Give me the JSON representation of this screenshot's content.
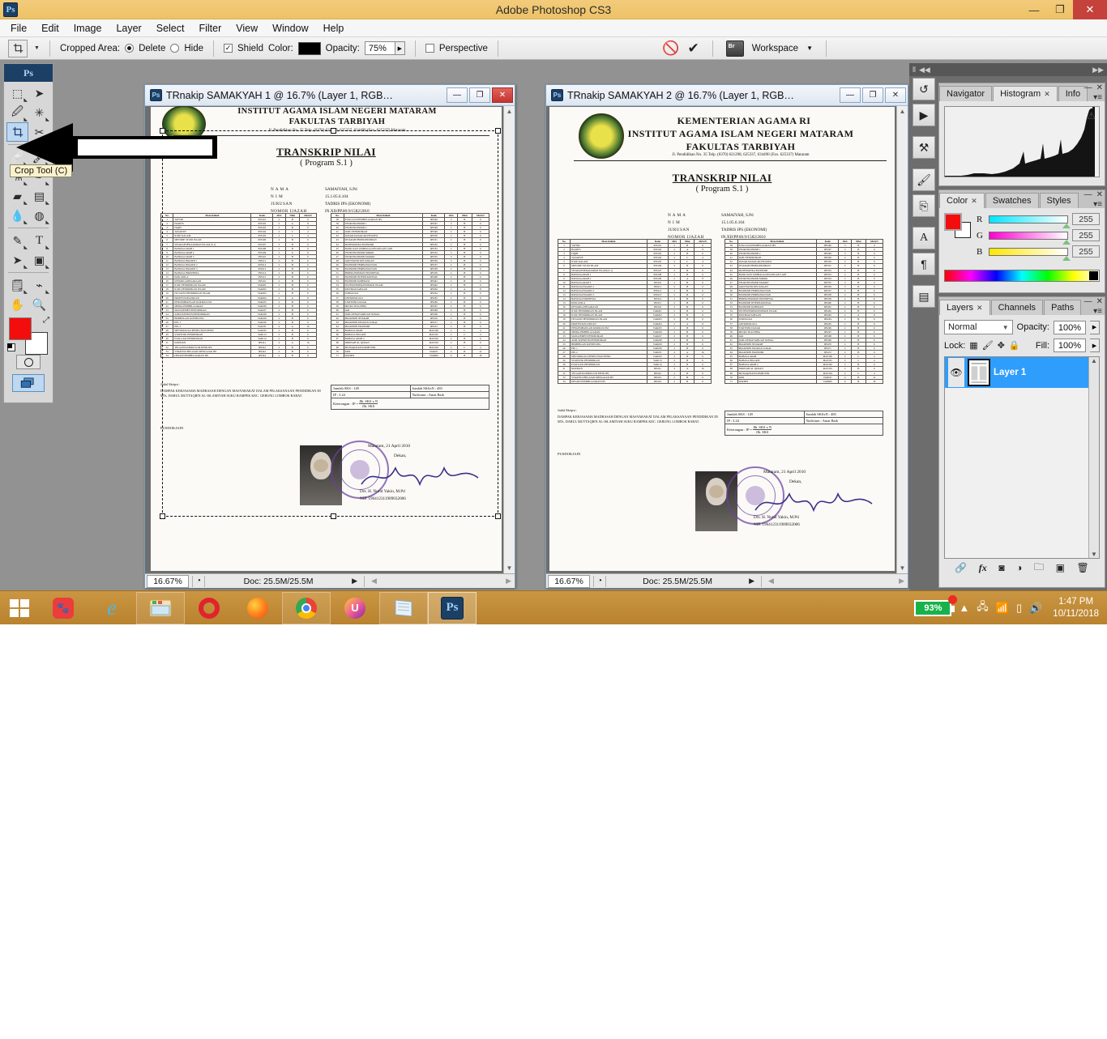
{
  "window": {
    "app_title": "Adobe Photoshop CS3",
    "app_badge": "Ps",
    "minimize": "—",
    "restore": "❐",
    "close": "✕"
  },
  "menubar": {
    "items": [
      "File",
      "Edit",
      "Image",
      "Layer",
      "Select",
      "Filter",
      "View",
      "Window",
      "Help"
    ]
  },
  "options_bar": {
    "tool_icon": "crop-tool-icon",
    "cropped_area_label": "Cropped Area:",
    "delete_label": "Delete",
    "hide_label": "Hide",
    "shield_label": "Shield",
    "color_label": "Color:",
    "color_value": "#000000",
    "opacity_label": "Opacity:",
    "opacity_value": "75%",
    "perspective_label": "Perspective",
    "cancel_icon": "cancel-crop-icon",
    "commit_icon": "commit-crop-icon",
    "bridge_icon": "go-to-bridge-icon",
    "workspace_label": "Workspace"
  },
  "toolbox": {
    "logo": "Ps",
    "tooltip": "Crop Tool (C)",
    "tools": [
      {
        "name": "marquee-tool",
        "glyph": "⬚"
      },
      {
        "name": "move-tool",
        "glyph": "➤"
      },
      {
        "name": "lasso-tool",
        "glyph": "✎"
      },
      {
        "name": "magic-wand-tool",
        "glyph": "✳"
      },
      {
        "name": "crop-tool",
        "glyph": "⌗",
        "selected": true
      },
      {
        "name": "slice-tool",
        "glyph": "✂"
      },
      {
        "name": "healing-brush-tool",
        "glyph": "✒"
      },
      {
        "name": "brush-tool",
        "glyph": "🖌"
      },
      {
        "name": "clone-stamp-tool",
        "glyph": "⚲"
      },
      {
        "name": "history-brush-tool",
        "glyph": "✏"
      },
      {
        "name": "eraser-tool",
        "glyph": "◻"
      },
      {
        "name": "gradient-tool",
        "glyph": "▤"
      },
      {
        "name": "blur-tool",
        "glyph": "💧"
      },
      {
        "name": "dodge-tool",
        "glyph": "◐"
      },
      {
        "name": "pen-tool",
        "glyph": "✑"
      },
      {
        "name": "type-tool",
        "glyph": "T"
      },
      {
        "name": "path-selection-tool",
        "glyph": "➚"
      },
      {
        "name": "rectangle-tool",
        "glyph": "▣"
      },
      {
        "name": "notes-tool",
        "glyph": "▤"
      },
      {
        "name": "eyedropper-tool",
        "glyph": "⌁"
      },
      {
        "name": "hand-tool",
        "glyph": "✋"
      },
      {
        "name": "zoom-tool",
        "glyph": "🔍"
      }
    ],
    "foreground_color": "#f40d0d",
    "background_color": "#ffffff",
    "quick_mask": "quick-mask-icon",
    "screen_mode": "screen-mode-icon"
  },
  "documents": [
    {
      "title": "TRnakip SAMAKYAH 1 @ 16.7% (Layer 1, RGB…",
      "zoom": "16.67%",
      "doc_size": "Doc: 25.5M/25.5M",
      "has_crop_marquee": true,
      "close_style": "red"
    },
    {
      "title": "TRnakip SAMAKYAH 2 @ 16.7% (Layer 1, RGB…",
      "zoom": "16.67%",
      "doc_size": "Doc: 25.5M/25.5M",
      "has_crop_marquee": false,
      "close_style": "grey"
    }
  ],
  "scanned_document": {
    "ministry": "KEMENTERIAN AGAMA RI",
    "institute": "INSTITUT AGAMA ISLAM NEGERI MATARAM",
    "faculty": "FAKULTAS TARBIYAH",
    "address": "Jl. Pendidikan No. 35 Telp. (0370) 621298, 625337, 634490 (Fax. 625337) Mataram",
    "doc_title": "TRANSKRIP NILAI",
    "doc_subtitle": "( Program S.1 )",
    "fields": [
      {
        "label": "N A M A",
        "value": "SAMAIYAH, S.Pd"
      },
      {
        "label": "N I M",
        "value": "15.1.05.6.104"
      },
      {
        "label": "JURUSAN",
        "value": "TADRIS IPS (EKONOMI)"
      },
      {
        "label": "NOMOR IJAZAH",
        "value": "IN.XII/PP.00.9/1582/2010"
      }
    ],
    "table_headers": [
      "No.",
      "Mata Kuliah",
      "Kode",
      "SKS",
      "Nilai",
      "SKSxN"
    ],
    "courses_left": [
      {
        "no": "1",
        "name": "TAFSIR",
        "kode": "INS101",
        "sks": "2",
        "nilai": "B",
        "sksn": "6"
      },
      {
        "no": "2",
        "name": "HADITS",
        "kode": "INS102",
        "sks": "2",
        "nilai": "A",
        "sksn": "8"
      },
      {
        "no": "3",
        "name": "FIQIH",
        "kode": "INS103",
        "sks": "2",
        "nilai": "B",
        "sksn": "6"
      },
      {
        "no": "4",
        "name": "TASAWUF",
        "kode": "INS104",
        "sks": "2",
        "nilai": "C",
        "sksn": "4"
      },
      {
        "no": "5",
        "name": "ILMU KALAM",
        "kode": "INS105",
        "sks": "2",
        "nilai": "C",
        "sksn": "4"
      },
      {
        "no": "6",
        "name": "METODE STUDI ISLAM",
        "kode": "INS106",
        "sks": "2",
        "nilai": "B",
        "sksn": "6"
      },
      {
        "no": "7",
        "name": "SEJARAH PERADABAN ISLAM (S-1)",
        "kode": "INS107",
        "sks": "2",
        "nilai": "B",
        "sksn": "6"
      },
      {
        "no": "8",
        "name": "BAHASA ARAB 1",
        "kode": "INS108",
        "sks": "2",
        "nilai": "B",
        "sksn": "6"
      },
      {
        "no": "9",
        "name": "BAHASA ARAB 2",
        "kode": "INS109",
        "sks": "2",
        "nilai": "A",
        "sksn": "8"
      },
      {
        "no": "10",
        "name": "BAHASA ARAB 3",
        "kode": "INS110",
        "sks": "2",
        "nilai": "B",
        "sksn": "6"
      },
      {
        "no": "11",
        "name": "BAHASA INGGRIS 1",
        "kode": "INS211",
        "sks": "2",
        "nilai": "B",
        "sksn": "6"
      },
      {
        "no": "12",
        "name": "BAHASA INGGRIS 2",
        "kode": "INS212",
        "sks": "2",
        "nilai": "B",
        "sksn": "6"
      },
      {
        "no": "13",
        "name": "BAHASA INGGRIS 3",
        "kode": "INS213",
        "sks": "2",
        "nilai": "B",
        "sksn": "6"
      },
      {
        "no": "14",
        "name": "BAHASA INDONESIA",
        "kode": "INS114",
        "sks": "2",
        "nilai": "B",
        "sksn": "6"
      },
      {
        "no": "15",
        "name": "PANCASILA",
        "kode": "INS115",
        "sks": "2",
        "nilai": "B",
        "sksn": "6"
      },
      {
        "no": "16",
        "name": "KEWARGANEGARAAN",
        "kode": "INS116",
        "sks": "2",
        "nilai": "B",
        "sksn": "6"
      },
      {
        "no": "17",
        "name": "ILMU PENDIDIKAN ISLAM",
        "kode": "TAR201",
        "sks": "2",
        "nilai": "B",
        "sksn": "6"
      },
      {
        "no": "18",
        "name": "ILMU PENDIDIKAN ISLAM",
        "kode": "TAR202",
        "sks": "2",
        "nilai": "B",
        "sksn": "6"
      },
      {
        "no": "19",
        "name": "FILSAFAT PENDIDIKAN ISLAM",
        "kode": "TAR203",
        "sks": "2",
        "nilai": "B",
        "sksn": "6"
      },
      {
        "no": "20",
        "name": "PROFESI KEGURUAN",
        "kode": "TAR204",
        "sks": "2",
        "nilai": "A",
        "sksn": "8"
      },
      {
        "no": "21",
        "name": "PENGEMBANGAN KURIKULUM",
        "kode": "TAR225",
        "sks": "2",
        "nilai": "B",
        "sksn": "6"
      },
      {
        "no": "22",
        "name": "MEDIA PEMBELAJARAN",
        "kode": "TAR226",
        "sks": "2",
        "nilai": "B",
        "sksn": "6"
      },
      {
        "no": "23",
        "name": "MANAJEMEN PENDIDIKAN",
        "kode": "TAR227",
        "sks": "2",
        "nilai": "B",
        "sksn": "6"
      },
      {
        "no": "24",
        "name": "ADM SUPERVISI PENDIDIKAN",
        "kode": "TAR228",
        "sks": "2",
        "nilai": "B",
        "sksn": "6"
      },
      {
        "no": "25",
        "name": "BIMBINGAN KONSELING",
        "kode": "TAR229",
        "sks": "2",
        "nilai": "B",
        "sksn": "6"
      },
      {
        "no": "26",
        "name": "PPL 1",
        "kode": "TAR230",
        "sks": "2",
        "nilai": "B",
        "sksn": "6"
      },
      {
        "no": "27",
        "name": "PPL 2",
        "kode": "TAR231",
        "sks": "4",
        "nilai": "A",
        "sksn": "16"
      },
      {
        "no": "28",
        "name": "METODOLOGI PENELITIAN PEND",
        "kode": "TAR232",
        "sks": "2",
        "nilai": "B",
        "sksn": "6"
      },
      {
        "no": "29",
        "name": "STATISTIK PENDIDIKAN",
        "kode": "TAR113",
        "sks": "2",
        "nilai": "B",
        "sksn": "6"
      },
      {
        "no": "30",
        "name": "EVALUASI PENDIDIKAN",
        "kode": "TAR114",
        "sks": "2",
        "nilai": "B",
        "sksn": "6"
      },
      {
        "no": "31",
        "name": "KKP/KKN",
        "kode": "IPS241",
        "sks": "4",
        "nilai": "A",
        "sksn": "16"
      },
      {
        "no": "32",
        "name": "TELAAH KURIKULUM PEND IPS",
        "kode": "IPS242",
        "sks": "2",
        "nilai": "B",
        "sksn": "6"
      },
      {
        "no": "33",
        "name": "STRATEGI BELAJAR MENGAJAR IPS",
        "kode": "IPS243",
        "sks": "2",
        "nilai": "B",
        "sksn": "6"
      },
      {
        "no": "34",
        "name": "DESAIN PEMBELAJARAN IPS",
        "kode": "IPS244",
        "sks": "2",
        "nilai": "B",
        "sksn": "6"
      }
    ],
    "courses_right": [
      {
        "no": "38",
        "name": "EVALUASI PEMBELAJARAN IPS",
        "kode": "IPS346",
        "sks": "3",
        "nilai": "B",
        "sksn": "9"
      },
      {
        "no": "39",
        "name": "TEORI EKONOMI 1",
        "kode": "IPS347",
        "sks": "3",
        "nilai": "B",
        "sksn": "9"
      },
      {
        "no": "40",
        "name": "TEORI EKONOMI 2",
        "kode": "IPS348",
        "sks": "3",
        "nilai": "B",
        "sksn": "9"
      },
      {
        "no": "41",
        "name": "ILMU PENDIDIKAN",
        "kode": "IPS349",
        "sks": "2",
        "nilai": "B",
        "sksn": "6"
      },
      {
        "no": "42",
        "name": "DASAR-DASAR AKUNTANSI",
        "kode": "IPS350",
        "sks": "3",
        "nilai": "B",
        "sksn": "9"
      },
      {
        "no": "43",
        "name": "SEJARAH PEREKONOMIAN",
        "kode": "IPS351",
        "sks": "2",
        "nilai": "B",
        "sksn": "6"
      },
      {
        "no": "44",
        "name": "MATEMATIKA EKONOMI",
        "kode": "IPS352",
        "sks": "2",
        "nilai": "B",
        "sksn": "6"
      },
      {
        "no": "45",
        "name": "BANK DAN LEMBAGA KEUANGAN LAIN",
        "kode": "IPS353",
        "sks": "2",
        "nilai": "B",
        "sksn": "6"
      },
      {
        "no": "46",
        "name": "TEORI EKONOMI MIKRO",
        "kode": "IPS354",
        "sks": "3",
        "nilai": "B",
        "sksn": "9"
      },
      {
        "no": "47",
        "name": "TEORI EKONOMI MAKRO",
        "kode": "IPS355",
        "sks": "3",
        "nilai": "B",
        "sksn": "9"
      },
      {
        "no": "48",
        "name": "AKUNTANSI KEUANGAN",
        "kode": "IPS356",
        "sks": "3",
        "nilai": "B",
        "sksn": "9"
      },
      {
        "no": "49",
        "name": "EKONOMI PEMBANGUNAN",
        "kode": "IPS357",
        "sks": "2",
        "nilai": "B",
        "sksn": "6"
      },
      {
        "no": "50",
        "name": "EKONOMI PEMBANGUNAN",
        "kode": "IPS358",
        "sks": "2",
        "nilai": "B",
        "sksn": "6"
      },
      {
        "no": "51",
        "name": "PEREKONOMIAN INDONESIA",
        "kode": "IPS359",
        "sks": "2",
        "nilai": "B",
        "sksn": "6"
      },
      {
        "no": "52",
        "name": "EKONOMI INTERNASIONAL",
        "kode": "IPS460",
        "sks": "2",
        "nilai": "B",
        "sksn": "6"
      },
      {
        "no": "53",
        "name": "EKONOMI KOPERASI",
        "kode": "IPS461",
        "sks": "2",
        "nilai": "B",
        "sksn": "6"
      },
      {
        "no": "54",
        "name": "SISTEM PEREKONOMIAN ISLAM",
        "kode": "IPS462",
        "sks": "2",
        "nilai": "B",
        "sksn": "6"
      },
      {
        "no": "55",
        "name": "KEWIRAUSAHAAN",
        "kode": "IPS463",
        "sks": "2",
        "nilai": "A",
        "sksn": "8"
      },
      {
        "no": "56",
        "name": "SOSIOLOGI",
        "kode": "IPS264",
        "sks": "2",
        "nilai": "B",
        "sksn": "6"
      },
      {
        "no": "57",
        "name": "ANTROPOLOGI",
        "kode": "IPS265",
        "sks": "2",
        "nilai": "B",
        "sksn": "6"
      },
      {
        "no": "58",
        "name": "STATISTIK DASAR",
        "kode": "IPS266",
        "sks": "2",
        "nilai": "B",
        "sksn": "6"
      },
      {
        "no": "59",
        "name": "MICRO TEACHING",
        "kode": "IPS267",
        "sks": "2",
        "nilai": "B",
        "sksn": "6"
      },
      {
        "no": "60",
        "name": "IAD",
        "kode": "IPS368",
        "sks": "2",
        "nilai": "B",
        "sksn": "6"
      },
      {
        "no": "61",
        "name": "ILMU PENGETAHUAN SOSIAL",
        "kode": "IPS369",
        "sks": "2",
        "nilai": "B",
        "sksn": "6"
      },
      {
        "no": "62",
        "name": "PRAKERIN SEJARAH",
        "kode": "IPS470",
        "sks": "2",
        "nilai": "B",
        "sksn": "6"
      },
      {
        "no": "63",
        "name": "PRAKERIN MUATAN LOKAL",
        "kode": "IPS471",
        "sks": "2",
        "nilai": "B",
        "sksn": "6"
      },
      {
        "no": "64",
        "name": "PRAKERIN EKONOMI",
        "kode": "IPS472",
        "sks": "2",
        "nilai": "B",
        "sksn": "6"
      },
      {
        "no": "65",
        "name": "BAHASA ARAB",
        "kode": "MAT100",
        "sks": "2",
        "nilai": "C",
        "sksn": "4"
      },
      {
        "no": "66",
        "name": "BAHASA INGGRIS",
        "kode": "MAT101",
        "sks": "2",
        "nilai": "C",
        "sksn": "4"
      },
      {
        "no": "67",
        "name": "BAHASA ARAB 2",
        "kode": "MAT102",
        "sks": "2",
        "nilai": "B",
        "sksn": "6"
      },
      {
        "no": "68",
        "name": "DIROSAH AL QURAN",
        "kode": "MAT103",
        "sks": "2",
        "nilai": "B",
        "sksn": "6"
      },
      {
        "no": "69",
        "name": "MUNAQOSAH KOMPUTER",
        "kode": "MAT104",
        "sks": "2",
        "nilai": "C",
        "sksn": "4"
      },
      {
        "no": "70",
        "name": "KKN",
        "kode": "TAR101",
        "sks": "4",
        "nilai": "B",
        "sksn": "12"
      },
      {
        "no": "71",
        "name": "SKRIPSI",
        "kode": "TAR600",
        "sks": "6",
        "nilai": "B",
        "sksn": "18"
      }
    ],
    "summary": {
      "jumlah_sks_label": "Jumlah SKS :",
      "jumlah_sks_value": "149",
      "jumlah_sksn_label": "Jumlah SKSxN :",
      "jumlah_sksn_value": "483",
      "ip_label": "IP :",
      "ip_value": "3.24",
      "yudisium_label": "Yudicium :",
      "yudisium_value": "Amat Baik",
      "keterangan_label": "Keterangan :",
      "keterangan_formula_num": "Jlh. SKS x N",
      "keterangan_formula_den": "Jlh. SKS",
      "keterangan_ip": "IP ="
    },
    "skripsi_label": "Judul Skripsi :",
    "skripsi_text": "DAMPAK KERJASAMA MADRASAH DENGAN MASYARAKAT DALAM PELAKSANAAN PENDIDIKAN DI MTs. DARUL MUTTAQIEN AL-ISLAMIYAH SUKU RAMPEK KEC. GERUNG LOMBOK BARAT.",
    "pusdokjain": "PUSDOKJAIN",
    "sign_place_date": "Mataram, 21 April 2010",
    "sign_role": "Dekan,",
    "sign_name": "Drs. H. Nurul Yakin, M.Pd",
    "sign_nip": "NIP. 196412311989032006"
  },
  "panels": {
    "top_group": {
      "tabs": [
        {
          "label": "Navigator",
          "active": false,
          "closable": false
        },
        {
          "label": "Histogram",
          "active": true,
          "closable": true
        },
        {
          "label": "Info",
          "active": false,
          "closable": false
        }
      ],
      "warning_icon": "cached-data-warning-icon",
      "minimize": "—",
      "close": "✕"
    },
    "color_group": {
      "tabs": [
        {
          "label": "Color",
          "active": true,
          "closable": true
        },
        {
          "label": "Swatches",
          "active": false,
          "closable": false
        },
        {
          "label": "Styles",
          "active": false,
          "closable": false
        }
      ],
      "channels": [
        {
          "label": "R",
          "value": "255"
        },
        {
          "label": "G",
          "value": "255"
        },
        {
          "label": "B",
          "value": "255"
        }
      ],
      "foreground": "#f40d0d",
      "background": "#ffffff"
    },
    "layers_group": {
      "tabs": [
        {
          "label": "Layers",
          "active": true,
          "closable": true
        },
        {
          "label": "Channels",
          "active": false,
          "closable": false
        },
        {
          "label": "Paths",
          "active": false,
          "closable": false
        }
      ],
      "blend_mode": "Normal",
      "opacity_label": "Opacity:",
      "opacity_value": "100%",
      "lock_label": "Lock:",
      "fill_label": "Fill:",
      "fill_value": "100%",
      "layers": [
        {
          "name": "Layer 1",
          "visible": true,
          "selected": true
        }
      ],
      "footer_icons": [
        "link-layers-icon",
        "layer-style-icon",
        "layer-mask-icon",
        "adjustment-layer-icon",
        "new-group-icon",
        "new-layer-icon",
        "delete-layer-icon"
      ]
    },
    "dock_icons": [
      "history-icon",
      "actions-icon",
      "tool-presets-icon",
      "brushes-icon",
      "clone-source-icon",
      "character-icon",
      "paragraph-icon",
      "layer-comps-icon"
    ]
  },
  "taskbar": {
    "start": "start-button",
    "apps": [
      {
        "name": "taskbar-app-bluestacks",
        "glyph": "●"
      },
      {
        "name": "taskbar-app-internet-explorer",
        "glyph": "e"
      },
      {
        "name": "taskbar-app-file-explorer",
        "glyph": "🗂"
      },
      {
        "name": "taskbar-app-opera",
        "glyph": "O"
      },
      {
        "name": "taskbar-app-firefox",
        "glyph": "🦊"
      },
      {
        "name": "taskbar-app-chrome",
        "glyph": "◎"
      },
      {
        "name": "taskbar-app-uc-browser",
        "glyph": "U"
      },
      {
        "name": "taskbar-app-notepad",
        "glyph": "📄"
      },
      {
        "name": "taskbar-app-photoshop",
        "glyph": "Ps"
      }
    ],
    "tray": {
      "battery_percent": "93%",
      "show_hidden_icons": "▲",
      "network_icon": "network-error-icon",
      "signal_icon": "signal-bars-icon",
      "device_icon": "mobile-device-icon",
      "volume_icon": "volume-icon",
      "time": "1:47 PM",
      "date": "10/11/2018"
    }
  }
}
